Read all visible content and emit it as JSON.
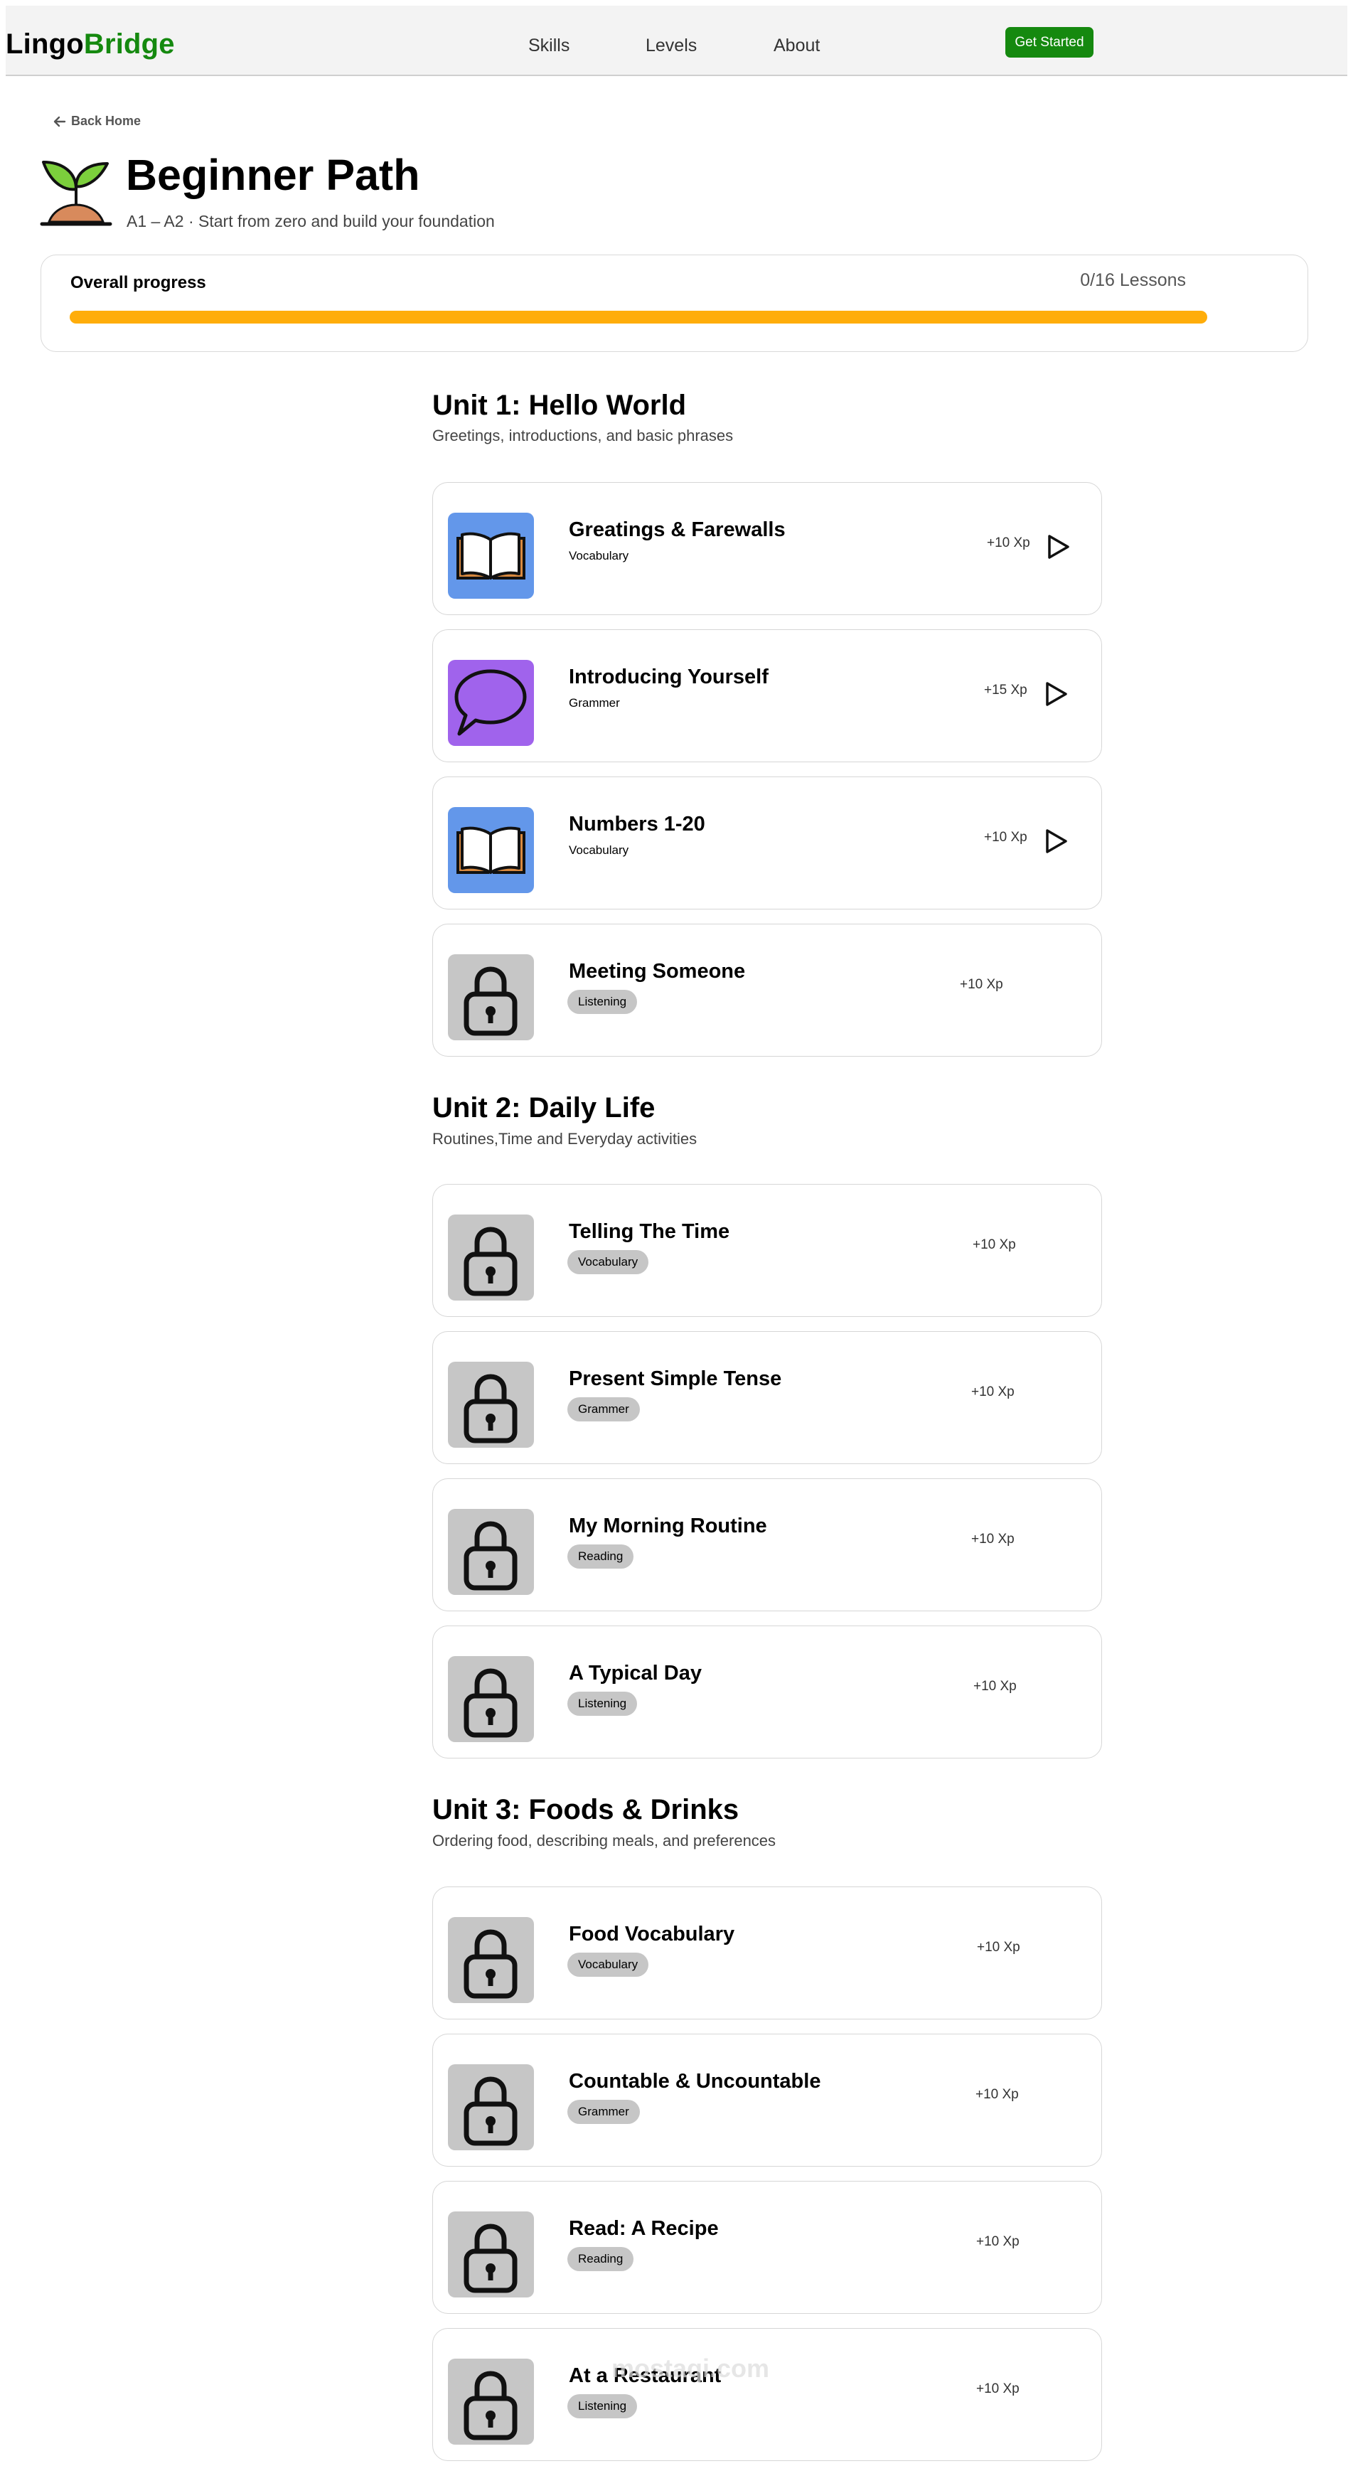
{
  "nav": {
    "logo_part1": "Lingo",
    "logo_part2": "Bridge",
    "links": [
      "Skills",
      "Levels",
      "About"
    ],
    "cta": "Get Started"
  },
  "header": {
    "back_label": "Back Home",
    "title": "Beginner Path",
    "subtitle": "A1 – A2 · Start from zero and build your foundation"
  },
  "progress": {
    "label": "Overall progress",
    "count_text": "0/16 Lessons",
    "completed_fraction": 0,
    "colors": {
      "track": "#ffad0a",
      "fill": "#15890f"
    }
  },
  "units": [
    {
      "title": "Unit 1: Hello World",
      "description": "Greetings, introductions, and basic phrases",
      "lessons": [
        {
          "title": "Greatings & Farewalls",
          "type": "Vocabulary",
          "xp": "+10 Xp",
          "icon": "book-icon",
          "locked": false
        },
        {
          "title": "Introducing Yourself",
          "type": "Grammer",
          "xp": "+15 Xp",
          "icon": "speech-bubble-icon",
          "locked": false
        },
        {
          "title": "Numbers 1-20",
          "type": "Vocabulary",
          "xp": "+10 Xp",
          "icon": "book-icon",
          "locked": false
        },
        {
          "title": "Meeting Someone",
          "type": "Listening",
          "xp": "+10 Xp",
          "icon": "lock-icon",
          "locked": true
        }
      ]
    },
    {
      "title": "Unit 2: Daily Life",
      "description": "Routines,Time and Everyday activities",
      "lessons": [
        {
          "title": "Telling The Time",
          "type": "Vocabulary",
          "xp": "+10 Xp",
          "icon": "lock-icon",
          "locked": true
        },
        {
          "title": "Present Simple Tense",
          "type": "Grammer",
          "xp": "+10 Xp",
          "icon": "lock-icon",
          "locked": true
        },
        {
          "title": "My Morning Routine",
          "type": "Reading",
          "xp": "+10 Xp",
          "icon": "lock-icon",
          "locked": true
        },
        {
          "title": "A Typical Day",
          "type": "Listening",
          "xp": "+10 Xp",
          "icon": "lock-icon",
          "locked": true
        }
      ]
    },
    {
      "title": "Unit 3: Foods & Drinks",
      "description": "Ordering food, describing meals, and preferences",
      "lessons": [
        {
          "title": "Food Vocabulary",
          "type": "Vocabulary",
          "xp": "+10 Xp",
          "icon": "lock-icon",
          "locked": true
        },
        {
          "title": "Countable & Uncountable",
          "type": "Grammer",
          "xp": "+10 Xp",
          "icon": "lock-icon",
          "locked": true
        },
        {
          "title": "Read: A Recipe",
          "type": "Reading",
          "xp": "+10 Xp",
          "icon": "lock-icon",
          "locked": true
        },
        {
          "title": "At a Restaurant",
          "type": "Listening",
          "xp": "+10 Xp",
          "icon": "lock-icon",
          "locked": true
        }
      ]
    }
  ],
  "watermark": "mostaqi.com"
}
